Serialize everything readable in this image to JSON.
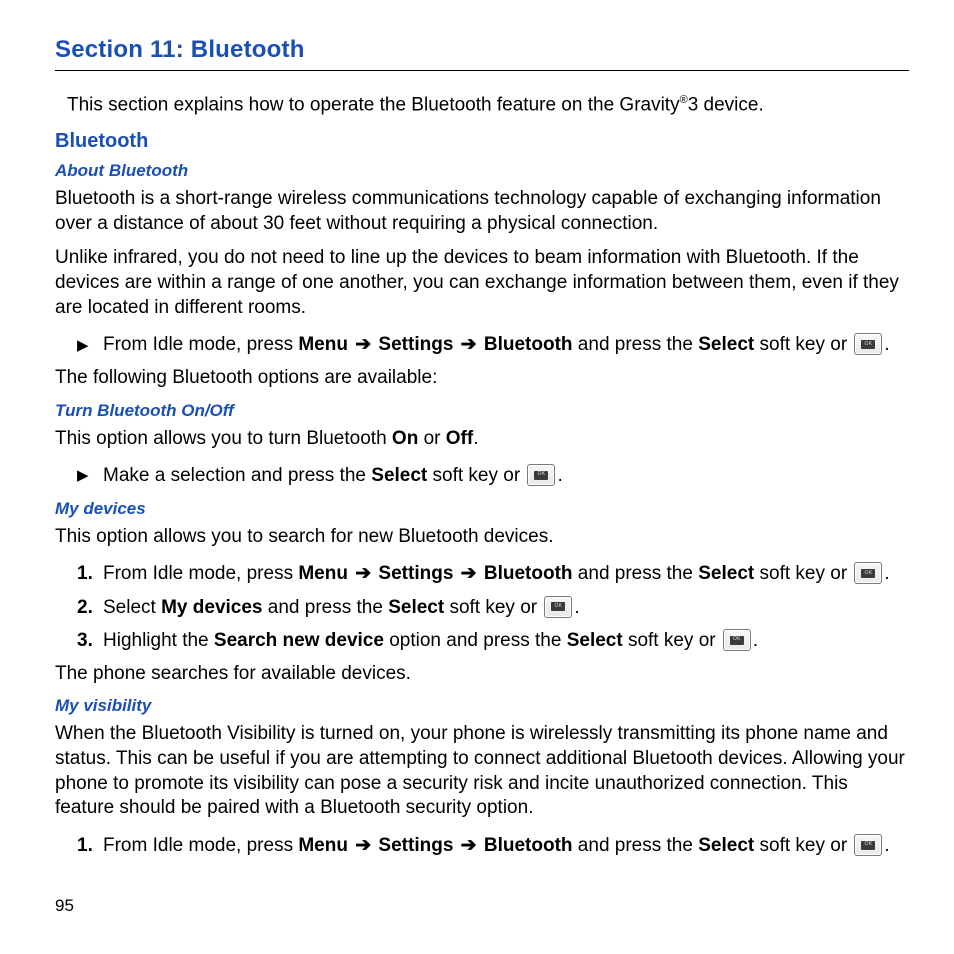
{
  "pageNumber": "95",
  "sectionTitle": "Section 11: Bluetooth",
  "intro": {
    "pre": "This section explains how to operate the Bluetooth feature on the Gravity",
    "post": "3 device."
  },
  "h2": "Bluetooth",
  "about": {
    "heading": "About Bluetooth",
    "p1": "Bluetooth is a short-range wireless communications technology capable of exchanging information over a distance of about 30 feet without requiring a physical connection.",
    "p2": "Unlike infrared, you do not need to line up the devices to beam information with Bluetooth. If the devices are within a range of one another, you can exchange information between them, even if they are located in different rooms.",
    "step": {
      "pre": "From Idle mode, press ",
      "menu": "Menu ",
      "settings": " Settings ",
      "bluetooth": " Bluetooth",
      "mid": " and press the ",
      "select": "Select",
      "post": " soft key or "
    },
    "p3": "The following Bluetooth options are available:"
  },
  "turn": {
    "heading": "Turn Bluetooth On/Off",
    "p1": {
      "pre": "This option allows you to turn Bluetooth ",
      "on": "On",
      "or": " or ",
      "off": "Off",
      "post": "."
    },
    "step": {
      "pre": "Make a selection and press the ",
      "select": "Select",
      "post": " soft key or "
    }
  },
  "mydev": {
    "heading": "My devices",
    "p1": "This option allows you to search for new Bluetooth devices.",
    "s1": {
      "num": "1.",
      "pre": "From Idle mode, press ",
      "menu": "Menu ",
      "settings": " Settings ",
      "bluetooth": " Bluetooth",
      "mid": " and press the ",
      "select": "Select",
      "post": " soft key or "
    },
    "s2": {
      "num": "2.",
      "pre": "Select ",
      "mydevices": "My devices",
      "mid": " and press the ",
      "select": "Select",
      "post": " soft key or "
    },
    "s3": {
      "num": "3.",
      "pre": "Highlight the ",
      "search": "Search new device",
      "mid": " option and press the ",
      "select": "Select",
      "post": " soft key or "
    },
    "p2": "The phone searches for available devices."
  },
  "myvis": {
    "heading": "My visibility",
    "p1": "When the Bluetooth Visibility is turned on, your phone is wirelessly transmitting its phone name and status. This can be useful if you are attempting to connect additional Bluetooth devices. Allowing your phone to promote its visibility can pose a security risk and incite unauthorized connection. This feature should be paired with a Bluetooth security option.",
    "s1": {
      "num": "1.",
      "pre": "From Idle mode, press ",
      "menu": "Menu ",
      "settings": " Settings ",
      "bluetooth": " Bluetooth",
      "mid": " and press the ",
      "select": "Select",
      "post": " soft key or "
    }
  },
  "arrow": "➔",
  "bullet": "▶"
}
